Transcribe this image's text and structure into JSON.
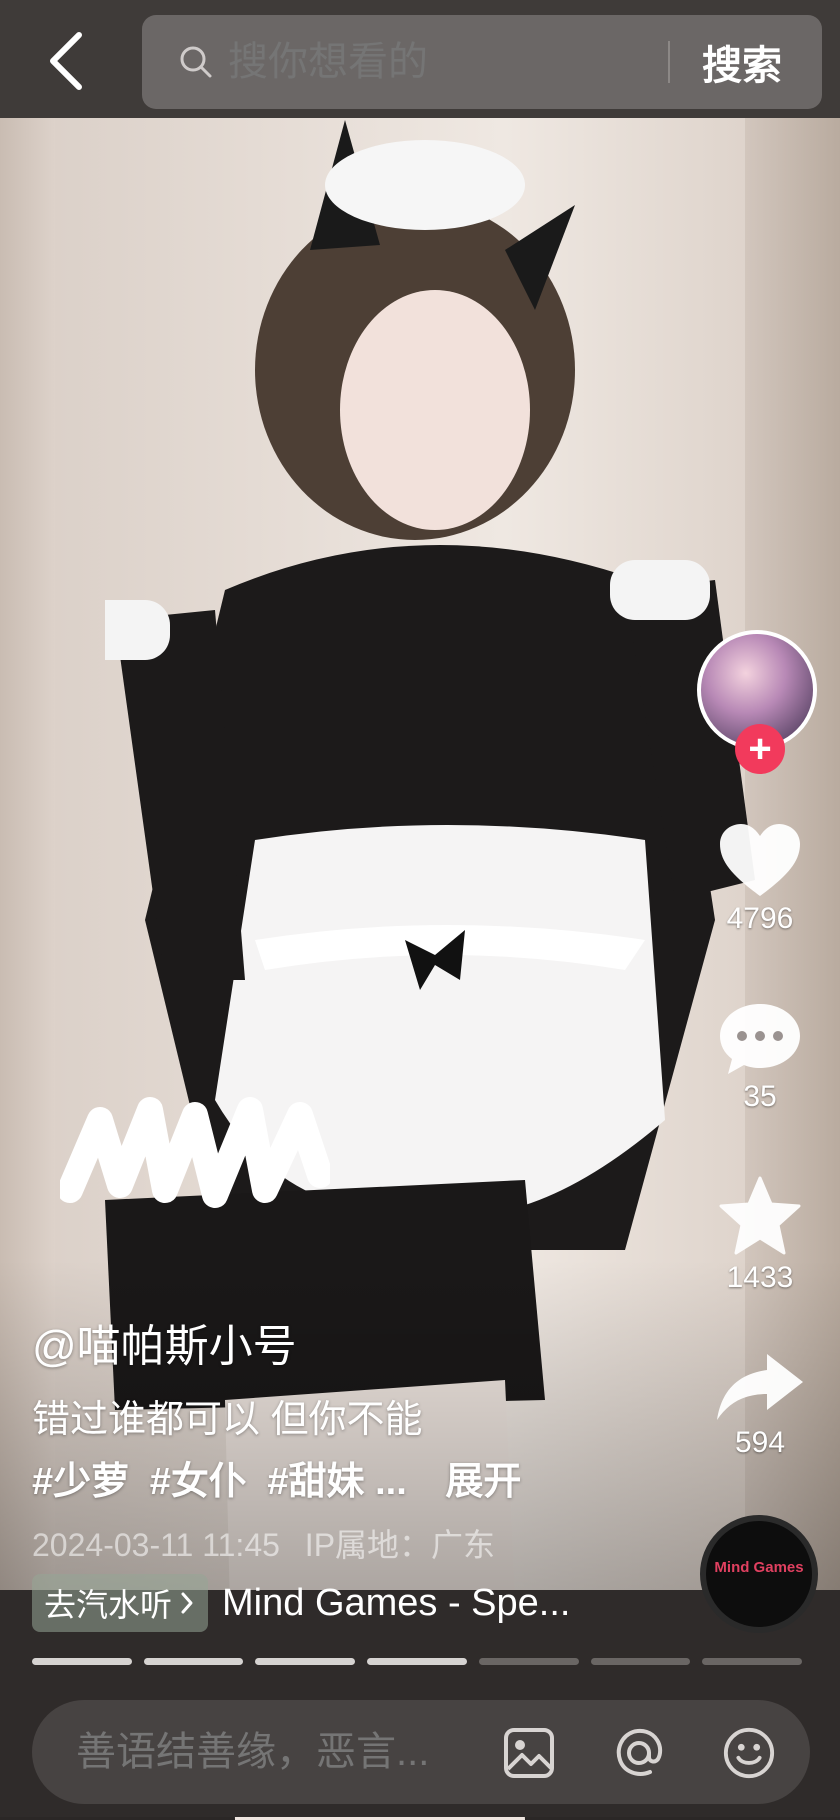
{
  "header": {
    "back_icon": "chevron-left-icon",
    "search_placeholder": "搜你想看的",
    "search_button": "搜索"
  },
  "sidebar": {
    "like_count": "4796",
    "comment_count": "35",
    "favorite_count": "1433",
    "share_count": "594",
    "follow_label": "+",
    "disc_text": "Mind Games"
  },
  "post": {
    "author": "@喵帕斯小号",
    "caption": "错过谁都可以 但你不能",
    "tags": [
      "#少萝",
      "#女仆",
      "#甜妹 ..."
    ],
    "expand_label": "展开",
    "timestamp": "2024-03-11 11:45",
    "ip_location": "IP属地：广东"
  },
  "music": {
    "chip_label": "去汽水听",
    "song": "Mind Games - Spe..."
  },
  "progress": {
    "segments": 7,
    "completed": 4
  },
  "comment": {
    "placeholder": "善语结善缘，恶言..."
  },
  "colors": {
    "follow": "#f23a5c",
    "bar": "#474342"
  }
}
